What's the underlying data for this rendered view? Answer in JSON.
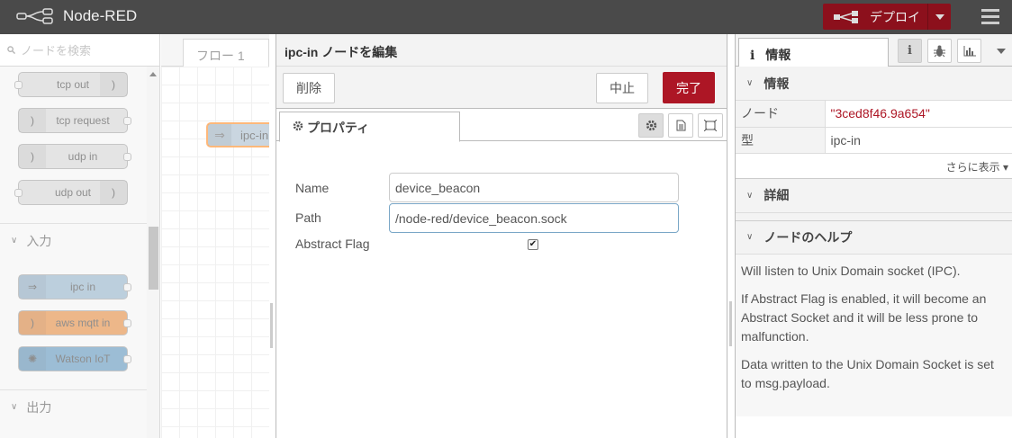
{
  "app": {
    "title": "Node-RED",
    "deploy_label": "デプロイ"
  },
  "palette": {
    "search_placeholder": "ノードを検索",
    "nodes_top": [
      {
        "label": "tcp out",
        "color": "#c0c0c0"
      },
      {
        "label": "tcp request",
        "color": "#c0c0c0"
      },
      {
        "label": "udp in",
        "color": "#c0c0c0"
      },
      {
        "label": "udp out",
        "color": "#c0c0c0"
      }
    ],
    "category_input": "入力",
    "nodes_input": [
      {
        "label": "ipc in",
        "color": "#87a9c3"
      },
      {
        "label": "aws mqtt in",
        "color": "#e07d2a"
      },
      {
        "label": "Watson IoT",
        "color": "#4d88b4"
      }
    ],
    "category_output": "出力"
  },
  "workspace": {
    "tab_label": "フロー 1",
    "node_label": "ipc-in"
  },
  "tray": {
    "title": "ipc-in ノードを編集",
    "delete_label": "削除",
    "cancel_label": "中止",
    "done_label": "完了",
    "tab_properties": "プロパティ",
    "form": {
      "name_label": "Name",
      "name_value": "device_beacon",
      "path_label": "Path",
      "path_value": "/node-red/device_beacon.sock",
      "abstract_label": "Abstract Flag",
      "abstract_checked": "✔"
    }
  },
  "sidebar": {
    "tab_label": "情報",
    "section_info": "情報",
    "rows": [
      {
        "key": "ノード",
        "value": "\"3ced8f46.9a654\""
      },
      {
        "key": "型",
        "value": "ipc-in"
      }
    ],
    "show_more": "さらに表示 ▾",
    "section_details": "詳細",
    "section_help": "ノードのヘルプ",
    "help": [
      "Will listen to Unix Domain socket (IPC).",
      "If Abstract Flag is enabled, it will become an Abstract Socket and it will be less prone to malfunction.",
      "Data written to the Unix Domain Socket is set to msg.payload."
    ]
  }
}
